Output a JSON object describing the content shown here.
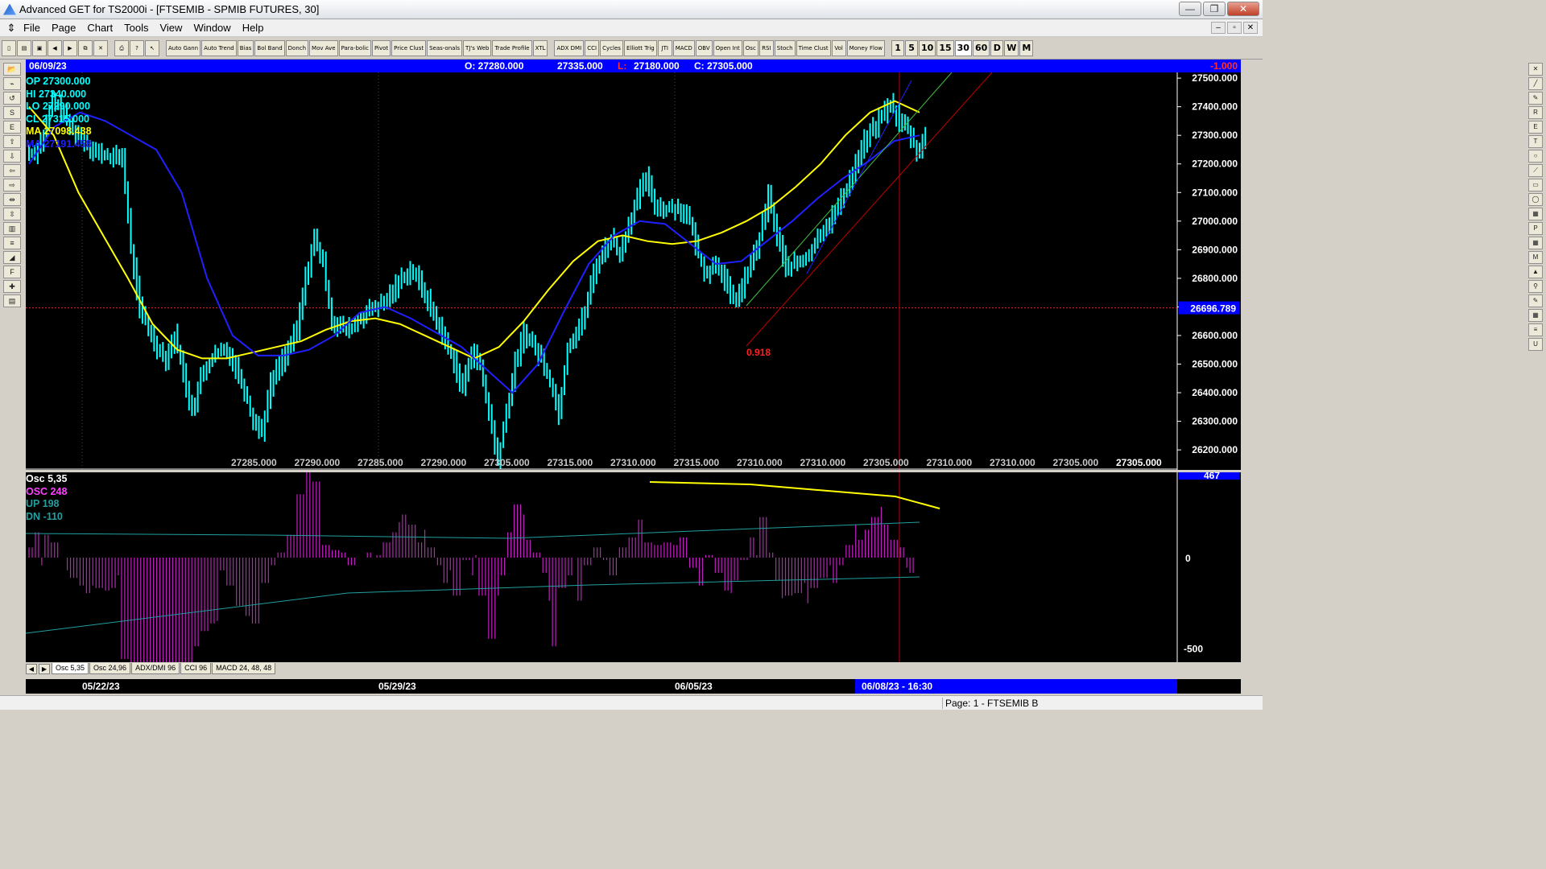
{
  "window": {
    "title": "Advanced GET for TS2000i - [FTSEMIB - SPMIB FUTURES, 30]",
    "min": "—",
    "max": "❐",
    "close": "✕"
  },
  "menu": [
    "File",
    "Page",
    "Chart",
    "Tools",
    "View",
    "Window",
    "Help"
  ],
  "toolbar": {
    "indicators": [
      "Auto Gann",
      "Auto Trend",
      "Bias",
      "Bol Band",
      "Donch",
      "Mov Ave",
      "Para-bolic",
      "Pivot",
      "Price Clust",
      "Seas-onals",
      "TJ's Web",
      "Trade Profile",
      "XTL",
      "ADX DMI",
      "CCI",
      "Cycles",
      "Elliott Trig",
      "JTI",
      "MACD",
      "OBV",
      "Open Int",
      "Osc",
      "RSI",
      "Stoch",
      "Time Clust",
      "Vol",
      "Money Flow"
    ],
    "intervals": [
      "1",
      "5",
      "10",
      "15",
      "30",
      "60",
      "D",
      "W",
      "M"
    ],
    "selected_interval": "30"
  },
  "infobar": {
    "date": "06/09/23",
    "open": "O: 27280.000",
    "high": "27335.000",
    "low_label": "L:",
    "low": "27180.000",
    "close": "C: 27305.000",
    "change": "-1.000"
  },
  "legend": {
    "op": "OP  27300.000",
    "hi": "HI   27340.000",
    "lo": "LO  27290.000",
    "cl": "CL  27315.000",
    "ma1": "MA  27098.438",
    "ma2": "MA  27191.458"
  },
  "price_axis": [
    "27500.000",
    "27400.000",
    "27300.000",
    "27200.000",
    "27100.000",
    "27000.000",
    "26900.000",
    "26800.000",
    "26700.000",
    "26600.000",
    "26500.000",
    "26400.000",
    "26300.000",
    "26200.000"
  ],
  "price_marker": "26696.789",
  "fib_label": "0.918",
  "bottom_values": [
    "27285.000",
    "27290.000",
    "27285.000",
    "27290.000",
    "27305.000",
    "27315.000",
    "27310.000",
    "27315.000",
    "27310.000",
    "27310.000",
    "27305.000",
    "27310.000",
    "27310.000",
    "27305.000",
    "27305.000"
  ],
  "oscillator": {
    "title": "Osc 5,35",
    "osc": "OSC 248",
    "up": "UP   198",
    "dn": "DN   -110",
    "axis": [
      "467",
      "0",
      "-500"
    ]
  },
  "tabs": [
    "Osc 5,35",
    "Osc 24,96",
    "ADX/DMI 96",
    "CCI 96",
    "MACD 24, 48, 48"
  ],
  "dates": [
    "05/22/23",
    "05/29/23",
    "06/05/23",
    "06/08/23 - 16:30"
  ],
  "status": "Page: 1 - FTSEMIB B",
  "colors": {
    "bar": "#00ffff",
    "ma_fast": "#ffff00",
    "ma_slow": "#2020ff",
    "osc": "#c020c0",
    "wave_label": "#ffff00",
    "abc_label": "#ff2020"
  },
  "chart_data": {
    "type": "candlestick",
    "ylim": [
      26130,
      27520
    ],
    "close_path": [
      27240,
      27300,
      27420,
      27390,
      27330,
      27300,
      27270,
      27240,
      27230,
      27220,
      27230,
      26900,
      26700,
      26620,
      26560,
      26520,
      26600,
      26470,
      26330,
      26450,
      26510,
      26540,
      26550,
      26490,
      26410,
      26300,
      26270,
      26430,
      26500,
      26550,
      26620,
      26800,
      26940,
      26850,
      26650,
      26630,
      26620,
      26650,
      26680,
      26700,
      26710,
      26760,
      26800,
      26830,
      26790,
      26720,
      26650,
      26580,
      26510,
      26410,
      26550,
      26490,
      26330,
      26160,
      26330,
      26500,
      26610,
      26570,
      26520,
      26440,
      26330,
      26560,
      26610,
      26680,
      26820,
      26890,
      26940,
      26880,
      26990,
      27080,
      27150,
      27060,
      27040,
      27050,
      27040,
      27000,
      26880,
      26810,
      26860,
      26790,
      26720,
      26770,
      26850,
      26940,
      27090,
      26950,
      26840,
      26850,
      26860,
      26900,
      26960,
      27000,
      27050,
      27120,
      27200,
      27280,
      27320,
      27370,
      27410,
      27350,
      27320,
      27240,
      27300
    ],
    "ma_fast": [
      27400,
      27300,
      27100,
      26950,
      26800,
      26640,
      26550,
      26520,
      26520,
      26540,
      26560,
      26580,
      26620,
      26650,
      26660,
      26640,
      26600,
      26560,
      26520,
      26560,
      26650,
      26760,
      26860,
      26930,
      26950,
      26930,
      26920,
      26930,
      26960,
      27000,
      27050,
      27120,
      27200,
      27300,
      27380,
      27420,
      27380
    ],
    "ma_slow": [
      27200,
      27330,
      27380,
      27350,
      27300,
      27250,
      27100,
      26800,
      26600,
      26530,
      26530,
      26550,
      26600,
      26680,
      26700,
      26660,
      26610,
      26560,
      26480,
      26400,
      26500,
      26680,
      26850,
      26950,
      27000,
      26990,
      26920,
      26850,
      26860,
      26930,
      27000,
      27080,
      27150,
      27210,
      27280,
      27300
    ]
  }
}
